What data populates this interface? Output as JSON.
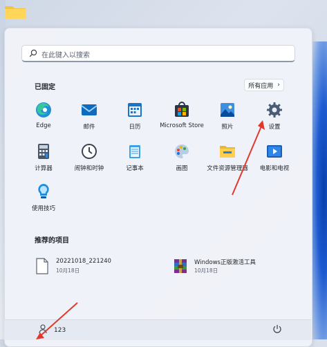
{
  "search": {
    "placeholder": "在此键入以搜索"
  },
  "pinned": {
    "title": "已固定",
    "all_apps_label": "所有应用",
    "apps": [
      {
        "label": "Edge",
        "icon": "edge-icon"
      },
      {
        "label": "邮件",
        "icon": "mail-icon"
      },
      {
        "label": "日历",
        "icon": "calendar-icon"
      },
      {
        "label": "Microsoft Store",
        "icon": "store-icon"
      },
      {
        "label": "照片",
        "icon": "photos-icon"
      },
      {
        "label": "设置",
        "icon": "settings-gear-icon"
      },
      {
        "label": "计算器",
        "icon": "calculator-icon"
      },
      {
        "label": "闹钟和时钟",
        "icon": "clock-icon"
      },
      {
        "label": "记事本",
        "icon": "notepad-icon"
      },
      {
        "label": "画图",
        "icon": "paint-icon"
      },
      {
        "label": "文件资源管理器",
        "icon": "folder-icon"
      },
      {
        "label": "电影和电视",
        "icon": "movies-icon"
      },
      {
        "label": "使用技巧",
        "icon": "tips-icon"
      }
    ]
  },
  "recommended": {
    "title": "推荐的项目",
    "items": [
      {
        "name": "20221018_221240",
        "date": "10月18日",
        "icon": "file-icon"
      },
      {
        "name": "Windows正版激活工具",
        "date": "10月18日",
        "icon": "winrar-icon"
      }
    ]
  },
  "footer": {
    "user_name": "123"
  },
  "colors": {
    "accent": "#0067c0",
    "arrow": "#e0392b"
  }
}
